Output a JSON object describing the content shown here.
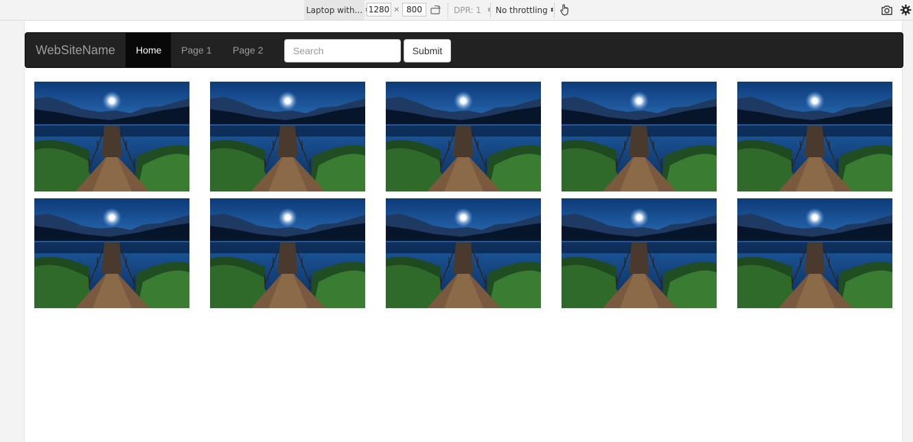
{
  "devtools": {
    "device": "Laptop with...",
    "width": "1280",
    "height": "800",
    "times": "×",
    "dpr": "DPR: 1",
    "throttling": "No throttling",
    "icons": [
      "rotate-icon",
      "touch-icon",
      "camera-icon",
      "gear-icon"
    ]
  },
  "navbar": {
    "brand": "WebSiteName",
    "links": [
      {
        "label": "Home",
        "active": true
      },
      {
        "label": "Page 1"
      },
      {
        "label": "Page 2"
      }
    ],
    "search_placeholder": "Search",
    "submit_label": "Submit"
  },
  "gallery": {
    "image": "moonlit-lake-pier-photo",
    "items": [
      {
        "image": "moonlit-lake-pier-photo"
      },
      {
        "image": "moonlit-lake-pier-photo"
      },
      {
        "image": "moonlit-lake-pier-photo"
      },
      {
        "image": "moonlit-lake-pier-photo"
      },
      {
        "image": "moonlit-lake-pier-photo"
      },
      {
        "image": "moonlit-lake-pier-photo"
      },
      {
        "image": "moonlit-lake-pier-photo"
      },
      {
        "image": "moonlit-lake-pier-photo"
      },
      {
        "image": "moonlit-lake-pier-photo"
      },
      {
        "image": "moonlit-lake-pier-photo"
      }
    ]
  },
  "colors": {
    "navbar_bg": "#222222",
    "navbar_active_bg": "#080808",
    "navbar_text": "#9d9d9d"
  }
}
